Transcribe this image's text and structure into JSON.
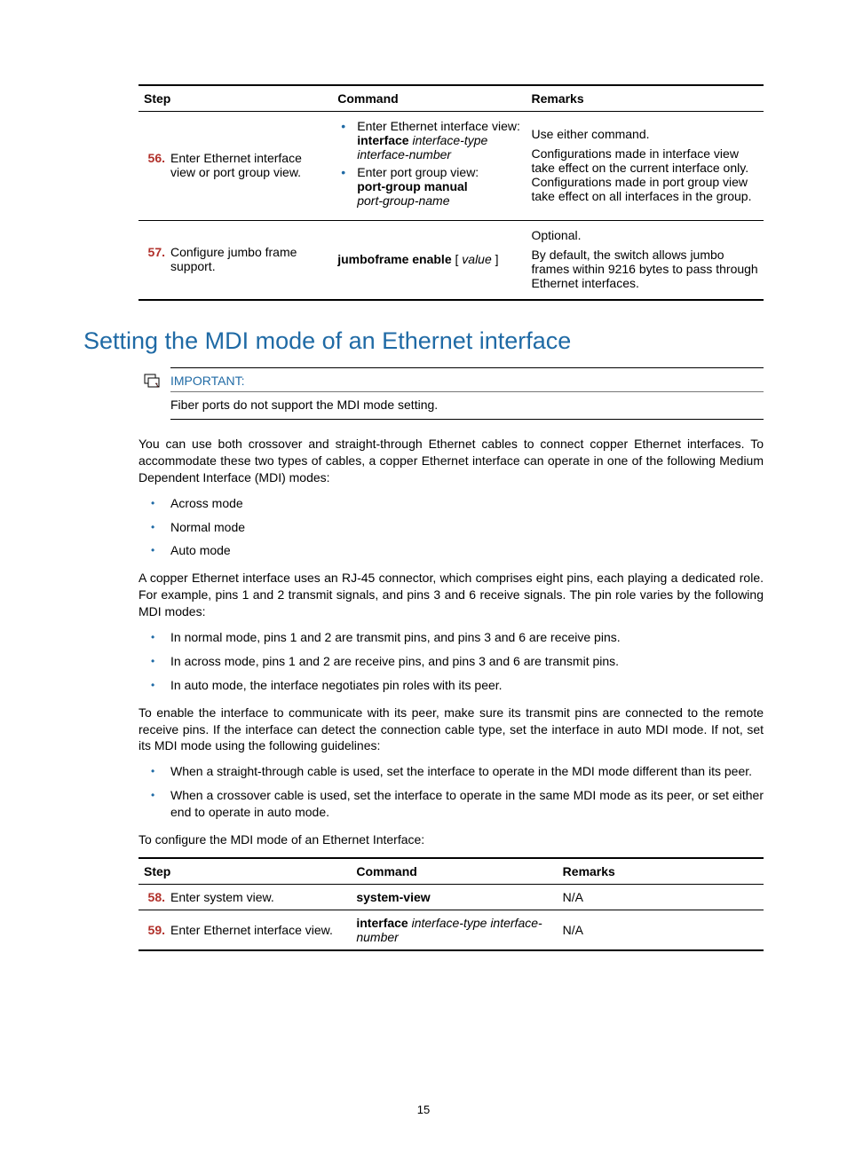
{
  "topTable": {
    "headers": {
      "step": "Step",
      "command": "Command",
      "remarks": "Remarks"
    },
    "row1": {
      "num": "56.",
      "step": "Enter Ethernet interface view or port group view.",
      "cmd_li1_intro": "Enter Ethernet interface view:",
      "cmd_li1_bold": "interface",
      "cmd_li1_ital": "interface-type interface-number",
      "cmd_li2_intro": "Enter port group view:",
      "cmd_li2_bold": "port-group manual",
      "cmd_li2_ital": "port-group-name",
      "rem_p1": "Use either command.",
      "rem_p2": "Configurations made in interface view take effect on the current interface only. Configurations made in port group view take effect on all interfaces in the group."
    },
    "row2": {
      "num": "57.",
      "step": "Configure jumbo frame support.",
      "cmd_bold": "jumboframe enable",
      "cmd_brkl": " [ ",
      "cmd_ital": "value",
      "cmd_brkr": " ]",
      "rem_p1": "Optional.",
      "rem_p2": "By default, the switch allows jumbo frames within 9216 bytes to pass through Ethernet interfaces."
    }
  },
  "sectionTitle": "Setting the MDI mode of an Ethernet interface",
  "important": {
    "title": "IMPORTANT:",
    "body": "Fiber ports do not support the MDI mode setting."
  },
  "para1": "You can use both crossover and straight-through Ethernet cables to connect copper Ethernet interfaces. To accommodate these two types of cables, a copper Ethernet interface can operate in one of the following Medium Dependent Interface (MDI) modes:",
  "modes": {
    "a": "Across mode",
    "b": "Normal mode",
    "c": "Auto mode"
  },
  "para2": "A copper Ethernet interface uses an RJ-45 connector, which comprises eight pins, each playing a dedicated role. For example, pins 1 and 2 transmit signals, and pins 3 and 6 receive signals. The pin role varies by the following MDI modes:",
  "pinModes": {
    "a": "In normal mode, pins 1 and 2 are transmit pins, and pins 3 and 6 are receive pins.",
    "b": "In across mode, pins 1 and 2 are receive pins, and pins 3 and 6 are transmit pins.",
    "c": "In auto mode, the interface negotiates pin roles with its peer."
  },
  "para3": "To enable the interface to communicate with its peer, make sure its transmit pins are connected to the remote receive pins. If the interface can detect the connection cable type, set the interface in auto MDI mode. If not, set its MDI mode using the following guidelines:",
  "guidelines": {
    "a": "When a straight-through cable is used, set the interface to operate in the MDI mode different than its peer.",
    "b": "When a crossover cable is used, set the interface to operate in the same MDI mode as its peer, or set either end to operate in auto mode."
  },
  "para4": "To configure the MDI mode of an Ethernet Interface:",
  "bottomTable": {
    "headers": {
      "step": "Step",
      "command": "Command",
      "remarks": "Remarks"
    },
    "row1": {
      "num": "58.",
      "step": "Enter system view.",
      "cmd_bold": "system-view",
      "rem": "N/A"
    },
    "row2": {
      "num": "59.",
      "step": "Enter Ethernet interface view.",
      "cmd_bold": "interface",
      "cmd_ital": "interface-type interface-number",
      "rem": "N/A"
    }
  },
  "pageNumber": "15"
}
